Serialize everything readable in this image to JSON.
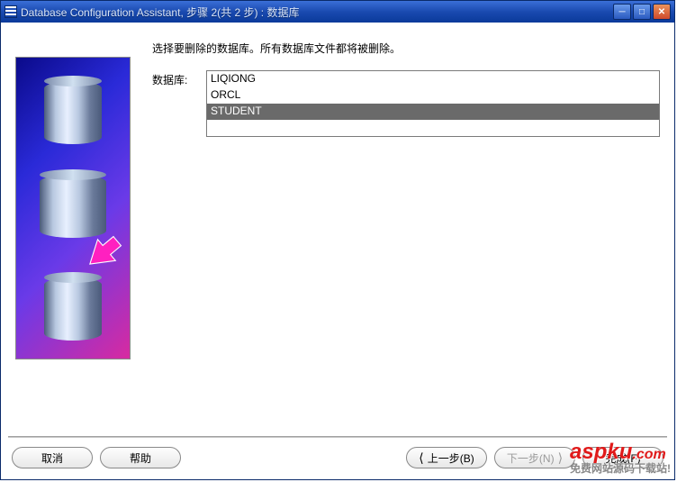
{
  "title": "Database Configuration Assistant, 步骤 2(共 2 步) : 数据库",
  "instruction": "选择要删除的数据库。所有数据库文件都将被删除。",
  "form": {
    "label": "数据库:"
  },
  "databases": [
    {
      "name": "LIQIONG",
      "selected": false
    },
    {
      "name": "ORCL",
      "selected": false
    },
    {
      "name": "STUDENT",
      "selected": true
    }
  ],
  "buttons": {
    "cancel": "取消",
    "help": "帮助",
    "back": "上一步(B)",
    "next": "下一步(N)",
    "finish": "完成(F)"
  },
  "watermark": {
    "main": "aspku",
    "suffix": ".com",
    "tag": "免费网站源码下载站!"
  }
}
